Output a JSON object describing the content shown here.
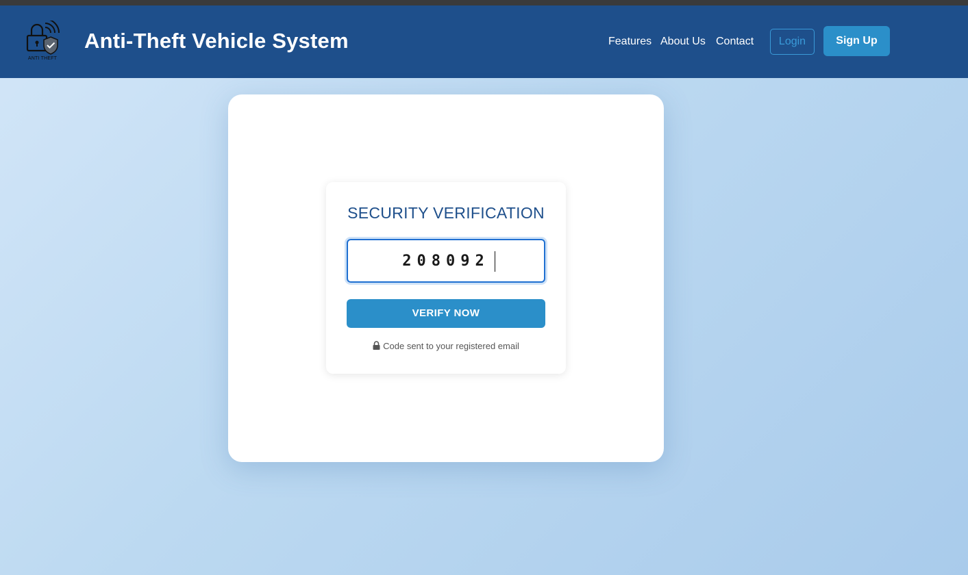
{
  "header": {
    "logo_caption": "ANTI THEFT",
    "app_title": "Anti-Theft Vehicle System",
    "nav": {
      "features": "Features",
      "about": "About Us",
      "contact": "Contact"
    },
    "login_label": "Login",
    "signup_label": "Sign Up"
  },
  "verification": {
    "title": "SECURITY VERIFICATION",
    "code_value": "208092",
    "button_label": "VERIFY NOW",
    "note": "Code sent to your registered email",
    "note_icon": "lock-icon"
  },
  "colors": {
    "header_bg": "#1e4f8b",
    "accent": "#2b8fc9",
    "title": "#1e4f8b",
    "input_border": "#1e6fd1"
  }
}
